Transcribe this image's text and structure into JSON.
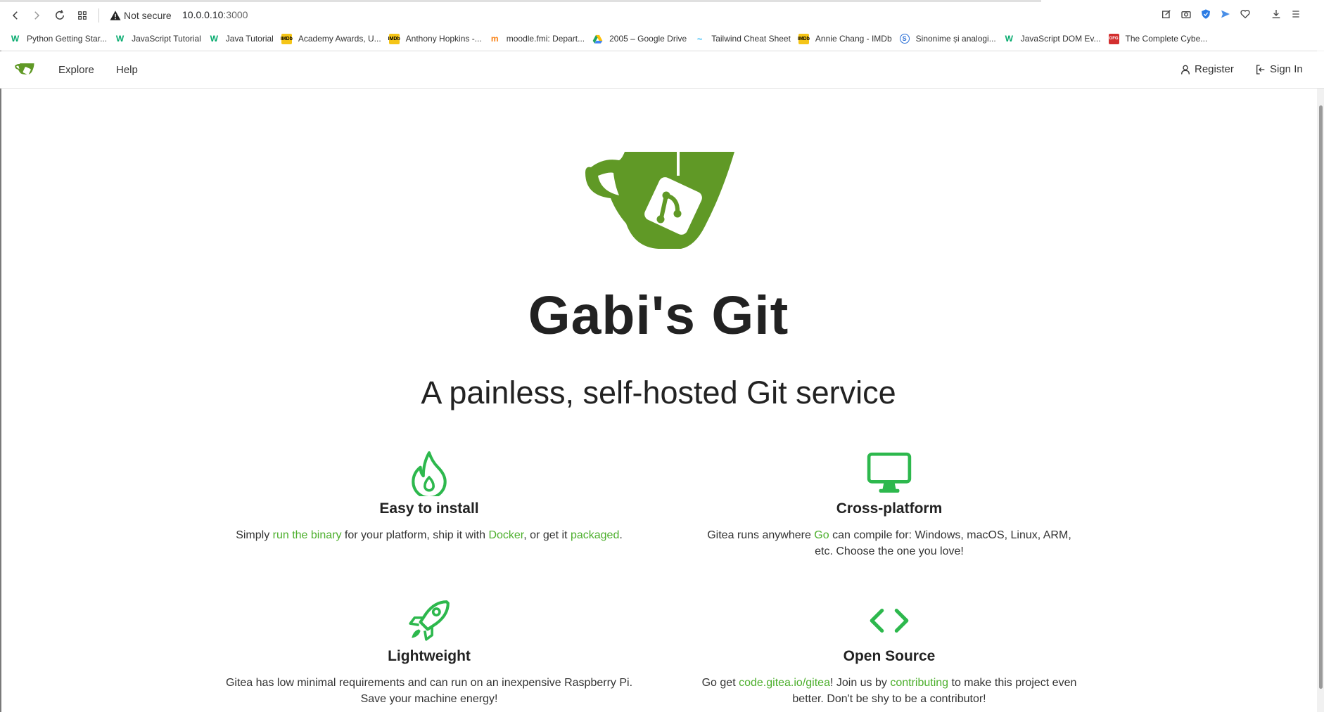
{
  "browser": {
    "security_label": "Not secure",
    "url_host": "10.0.0.10",
    "url_port": ":3000",
    "bookmarks": [
      {
        "label": "Python Getting Star...",
        "icon": "w3schools-icon",
        "color": "#04aa6d"
      },
      {
        "label": "JavaScript Tutorial",
        "icon": "w3schools-icon",
        "color": "#04aa6d"
      },
      {
        "label": "Java Tutorial",
        "icon": "w3schools-icon",
        "color": "#04aa6d"
      },
      {
        "label": "Academy Awards, U...",
        "icon": "imdb-icon",
        "color": "#f5c518"
      },
      {
        "label": "Anthony Hopkins -...",
        "icon": "imdb-icon",
        "color": "#f5c518"
      },
      {
        "label": "moodle.fmi: Depart...",
        "icon": "moodle-icon",
        "color": "#f98012"
      },
      {
        "label": "2005 – Google Drive",
        "icon": "google-drive-icon",
        "color": "#1fa463"
      },
      {
        "label": "Tailwind Cheat Sheet",
        "icon": "tailwind-icon",
        "color": "#38bdf8"
      },
      {
        "label": "Annie Chang - IMDb",
        "icon": "imdb-icon",
        "color": "#f5c518"
      },
      {
        "label": "Sinonime și analogi...",
        "icon": "sinonime-icon",
        "color": "#2a6fd6"
      },
      {
        "label": "JavaScript DOM Ev...",
        "icon": "w3schools-icon",
        "color": "#04aa6d"
      },
      {
        "label": "The Complete Cybe...",
        "icon": "gfg-icon",
        "color": "#d32f2f"
      }
    ]
  },
  "navbar": {
    "explore": "Explore",
    "help": "Help",
    "register": "Register",
    "sign_in": "Sign In"
  },
  "hero": {
    "title": "Gabi's Git",
    "subtitle": "A painless, self-hosted Git service"
  },
  "colors": {
    "brand_green": "#609926",
    "accent_green": "#4caf2c"
  },
  "features": {
    "install": {
      "icon": "flame-icon",
      "title": "Easy to install",
      "d1": "Simply ",
      "l1": "run the binary",
      "d2": " for your platform, ship it with ",
      "l2": "Docker",
      "d3": ", or get it ",
      "l3": "packaged",
      "d4": "."
    },
    "cross": {
      "icon": "monitor-icon",
      "title": "Cross-platform",
      "d1": "Gitea runs anywhere ",
      "l1": "Go",
      "d2": " can compile for: Windows, macOS, Linux, ARM, etc. Choose the one you love!"
    },
    "light": {
      "icon": "rocket-icon",
      "title": "Lightweight",
      "d1": "Gitea has low minimal requirements and can run on an inexpensive Raspberry Pi. Save your machine energy!"
    },
    "open": {
      "icon": "code-icon",
      "title": "Open Source",
      "d1": "Go get ",
      "l1": "code.gitea.io/gitea",
      "d2": "! Join us by ",
      "l2": "contributing",
      "d3": " to make this project even better. Don't be shy to be a contributor!"
    }
  }
}
